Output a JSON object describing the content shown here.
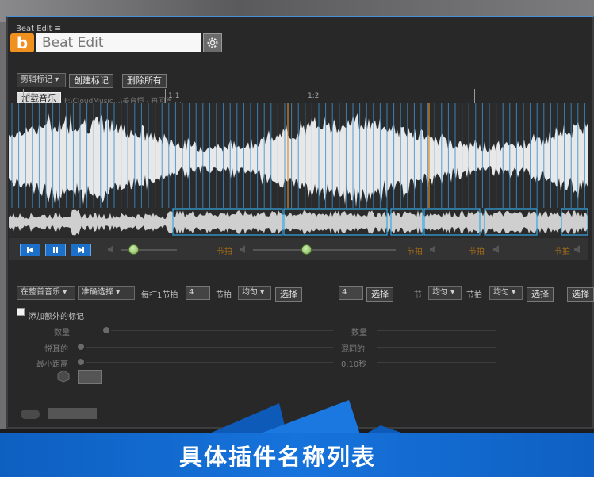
{
  "window": {
    "title": "Beat Edit",
    "menu_icon": "hamburger-icon"
  },
  "header": {
    "logo_letter": "b",
    "title": "Beat Edit",
    "settings_icon": "gear-icon"
  },
  "toolbar": {
    "marker_dropdown": "剪辑标记 ▾",
    "create_marker": "创建标记",
    "delete_all": "删除所有",
    "load_music": "加载音乐",
    "file_path": "F:\\CloudMusic...\\姜育恒 - 再回首 ..."
  },
  "timeline": {
    "ticks": [
      "60",
      "1:1",
      "1:2"
    ]
  },
  "transport": {
    "prev_icon": "skip-back-icon",
    "pause_icon": "pause-icon",
    "next_icon": "skip-forward-icon",
    "volume_icon": "speaker-icon",
    "beat_label": "节拍"
  },
  "options": {
    "scope_select": "在整首音乐 ▾",
    "precision_select": "准确选择 ▾",
    "every_label": "每打1节拍",
    "beat_count": "4",
    "beat_label": "节拍",
    "mode_select": "均匀 ▾",
    "choose_button": "选择",
    "beat_count_2": "4",
    "choose_button_2": "选择",
    "mode_select_2": "均匀 ▾",
    "beat_label_2": "节拍",
    "mode_select_3": "均匀 ▾",
    "choose_button_3": "选择",
    "choose_button_4": "选择"
  },
  "extra": {
    "add_extra_markers": "添加额外的标记",
    "count_label": "数量",
    "beat_heard_label": "悦耳的",
    "min_distance_label": "最小距离",
    "count_label_2": "数量",
    "mix_label": "混同的",
    "min_distance_value": "0.10秒"
  },
  "banner": {
    "title": "具体插件名称列表"
  },
  "colors": {
    "accent": "#1d70c9",
    "logo": "#f0901e",
    "waveform": "#e8e8e8",
    "beat_line": "#3a8fd0"
  }
}
